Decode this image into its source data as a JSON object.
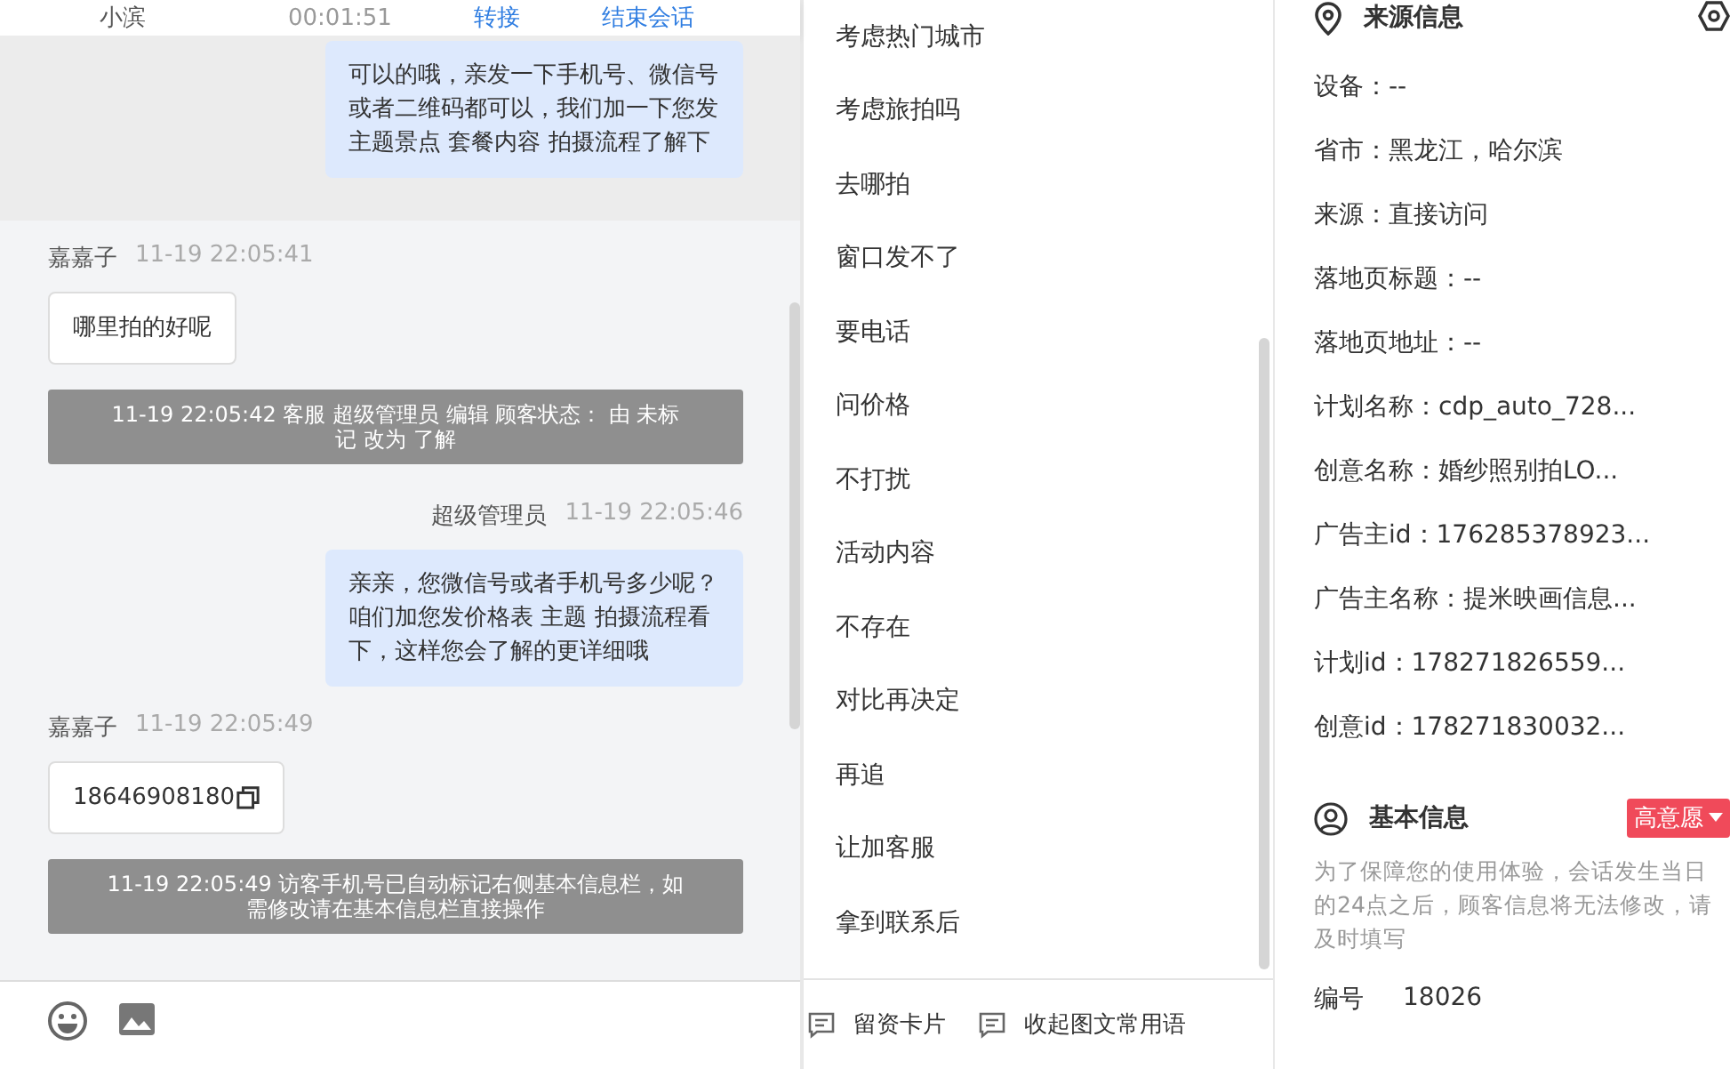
{
  "session_header": {
    "visitor": "小滨",
    "duration": "00:01:51",
    "actions": [
      "转接",
      "结束会话"
    ]
  },
  "messages": [
    {
      "kind": "agent",
      "highlighted": true,
      "text": "可以的哦，亲发一下手机号、微信号或者二维码都可以，我们加一下您发主题景点 套餐内容 拍摄流程了解下"
    },
    {
      "kind": "customer",
      "sender": "嘉嘉子",
      "time": "11-19 22:05:41",
      "text": "哪里拍的好呢",
      "copyable": false
    },
    {
      "kind": "system",
      "text": "11-19 22:05:42 客服 超级管理员 编辑 顾客状态： 由 未标记 改为 了解"
    },
    {
      "kind": "agent",
      "highlighted": false,
      "sender": "超级管理员",
      "time": "11-19 22:05:46",
      "text": "亲亲，您微信号或者手机号多少呢？咱们加您发价格表 主题 拍摄流程看下，这样您会了解的更详细哦"
    },
    {
      "kind": "customer",
      "sender": "嘉嘉子",
      "time": "11-19 22:05:49",
      "text": "18646908180",
      "copyable": true
    },
    {
      "kind": "system",
      "text": "11-19 22:05:49 访客手机号已自动标记右侧基本信息栏，如需修改请在基本信息栏直接操作"
    }
  ],
  "quick_replies": [
    "考虑热门城市",
    "考虑旅拍吗",
    "去哪拍",
    "窗口发不了",
    "要电话",
    "问价格",
    "不打扰",
    "活动内容",
    "不存在",
    "对比再决定",
    "再追",
    "让加客服",
    "拿到联系后"
  ],
  "quick_bar": [
    "留资卡片",
    "收起图文常用语"
  ],
  "source_info": {
    "title": "来源信息",
    "fields": [
      "设备：--",
      "省市：黑龙江，哈尔滨",
      "来源：直接访问",
      "落地页标题：--",
      "落地页地址：--",
      "计划名称：cdp_auto_728...",
      "创意名称：婚纱照别拍LO...",
      "广告主id：176285378923...",
      "广告主名称：提米映画信息...",
      "计划id：178271826559...",
      "创意id：178271830032..."
    ]
  },
  "basic_info": {
    "title": "基本信息",
    "intent_tag": "高意愿",
    "note": "为了保障您的使用体验，会话发生当日的24点之后，顾客信息将无法修改，请及时填写",
    "fields": [
      {
        "label": "编号",
        "value": "18026"
      }
    ]
  }
}
